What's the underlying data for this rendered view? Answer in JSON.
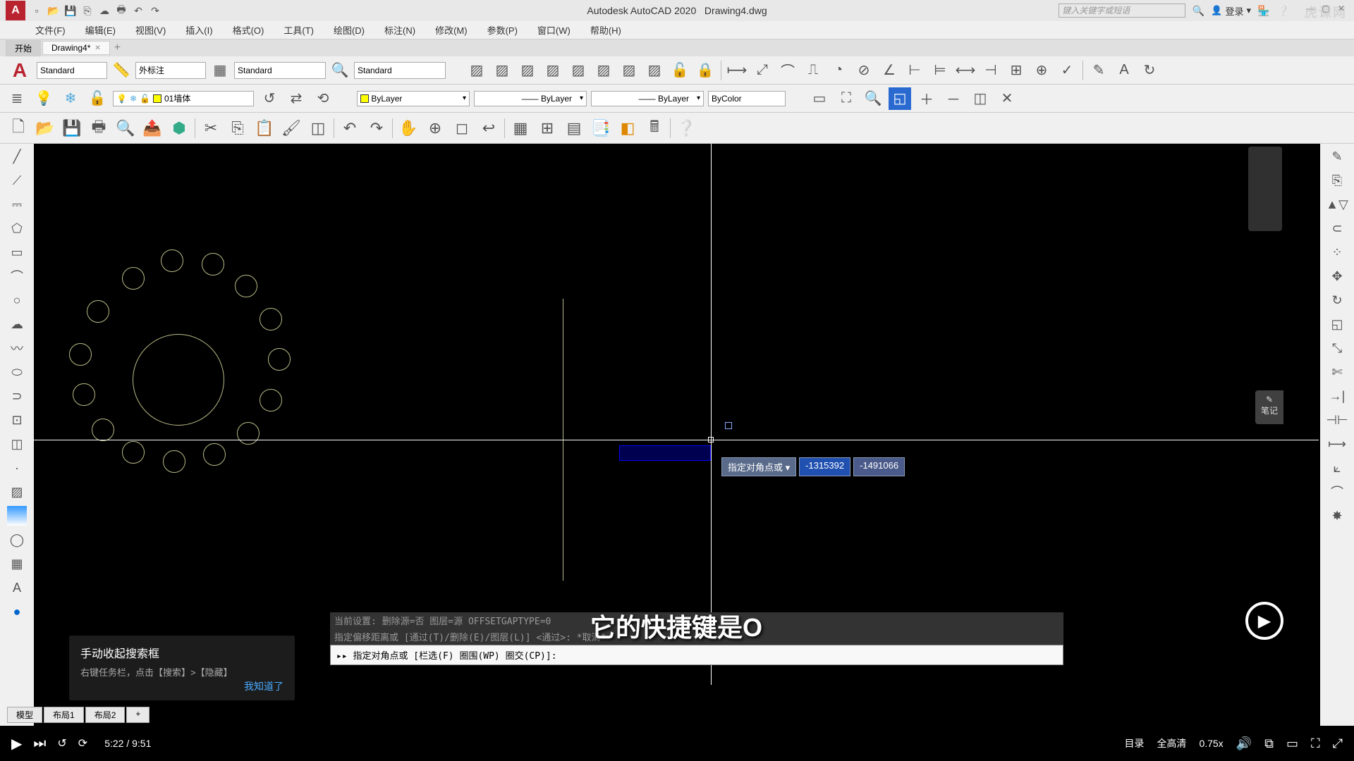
{
  "app": {
    "title_left": "Autodesk AutoCAD 2020",
    "title_right": "Drawing4.dwg",
    "search_placeholder": "键入关键字或短语",
    "login_label": "登录"
  },
  "menus": [
    "文件(F)",
    "编辑(E)",
    "视图(V)",
    "插入(I)",
    "格式(O)",
    "工具(T)",
    "绘图(D)",
    "标注(N)",
    "修改(M)",
    "参数(P)",
    "窗口(W)",
    "帮助(H)"
  ],
  "tabs": {
    "start": "开始",
    "doc": "Drawing4*"
  },
  "style_bar": {
    "text_style": "Standard",
    "dim_style": "外标注",
    "table_style": "Standard",
    "mleader_style": "Standard"
  },
  "layer": {
    "current": "01墙体",
    "prop1": "ByLayer",
    "prop2": "ByLayer",
    "prop3": "ByColor"
  },
  "dynamic_input": {
    "label": "指定对角点或",
    "x": "-1315392",
    "y": "-1491066"
  },
  "command": {
    "hist1": "当前设置: 删除源=否   图层=源   OFFSETGAPTYPE=0",
    "hist2": "指定偏移距离或 [通过(T)/删除(E)/图层(L)] <通过>: *取消*",
    "prompt": "▸▸ 指定对角点或 [栏选(F) 圈围(WP) 圈交(CP)]:"
  },
  "tooltip": {
    "title": "手动收起搜索框",
    "text": "右键任务栏，点击【搜索】>【隐藏】",
    "ok": "我知道了"
  },
  "model_tabs": [
    "模型",
    "布局1",
    "布局2"
  ],
  "subtitle": "它的快捷键是O",
  "notes_label": "笔记",
  "video": {
    "current_time": "5:22",
    "total_time": "9:51",
    "toc": "目录",
    "quality": "全高清",
    "speed": "0.75x"
  },
  "watermark": "虎课网"
}
